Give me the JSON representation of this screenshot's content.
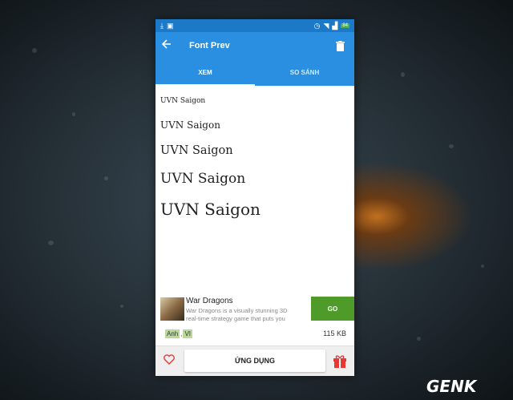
{
  "status_bar": {
    "battery": "84"
  },
  "app_bar": {
    "title": "Font Prev"
  },
  "tabs": [
    {
      "label": "XEM",
      "active": true
    },
    {
      "label": "SO SÁNH",
      "active": false
    }
  ],
  "preview": {
    "samples": [
      "UVN Saigon",
      "UVN Saigon",
      "UVN Saigon",
      "UVN Saigon",
      "UVN Saigon"
    ]
  },
  "ad": {
    "title": "War Dragons",
    "description": "War Dragons is a visually stunning 3D real-time strategy game that puts you",
    "go_label": "GO",
    "tags": [
      "Anh",
      "VI"
    ],
    "tag_separator": ",",
    "size": "115 KB"
  },
  "bottom_bar": {
    "apps_label": "ỨNG DỤNG"
  },
  "watermark": {
    "text": "GENK"
  },
  "colors": {
    "accent": "#2a8fe0",
    "status": "#1c79c8",
    "go": "#4f9b2a"
  },
  "icons": {
    "back": "arrow-left-icon",
    "delete": "trash-icon",
    "favorite": "heart-icon",
    "gift": "gift-icon"
  }
}
